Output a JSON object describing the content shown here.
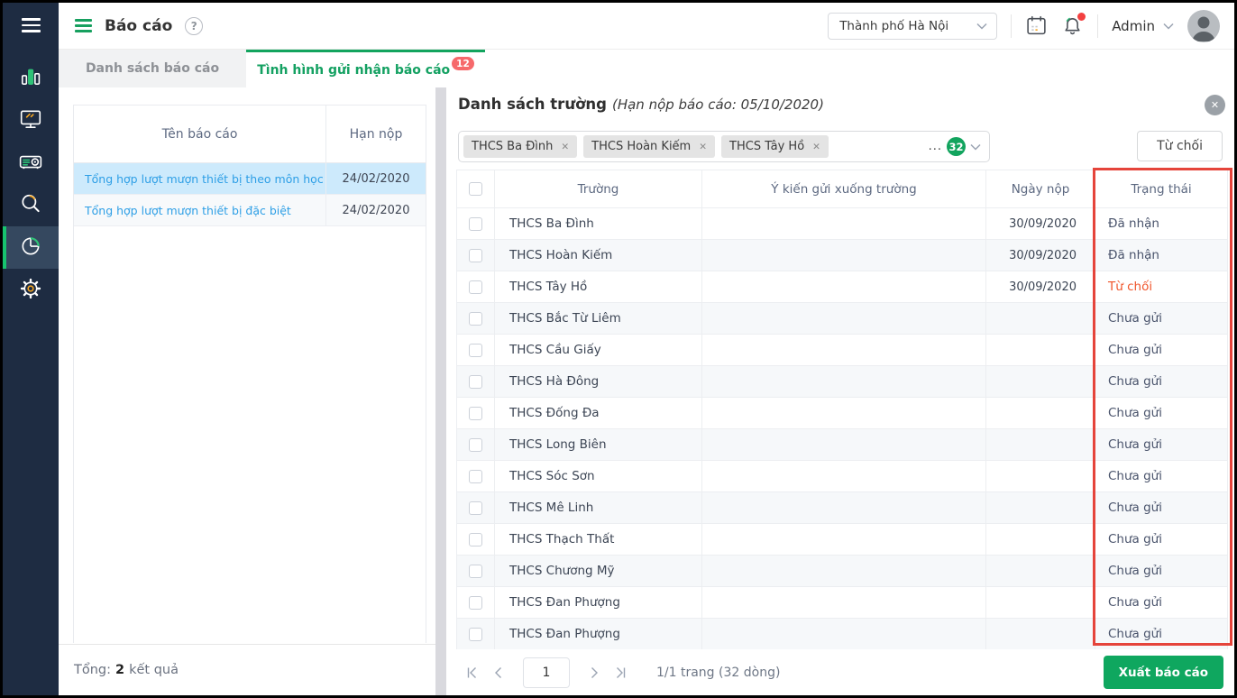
{
  "sidebar": {
    "icons": [
      "bar-chart",
      "monitor",
      "projector",
      "search",
      "pie-chart",
      "settings"
    ],
    "active_icon": "pie-chart"
  },
  "topbar": {
    "title": "Báo cáo",
    "region_select": "Thành phố Hà Nội",
    "username": "Admin"
  },
  "tabs": {
    "tab1": "Danh sách báo cáo",
    "tab2": "Tình hình gửi nhận báo cáo",
    "tab2_badge": "12"
  },
  "left_panel": {
    "columns": {
      "name": "Tên báo cáo",
      "deadline": "Hạn nộp"
    },
    "rows": [
      {
        "name": "Tổng hợp lượt mượn thiết bị theo môn học",
        "deadline": "24/02/2020",
        "selected": true
      },
      {
        "name": "Tổng hợp lượt mượn thiết bị đặc biệt",
        "deadline": "24/02/2020",
        "selected": false
      }
    ],
    "footer": {
      "label": "Tổng:",
      "value": "2",
      "suffix": "kết quả"
    }
  },
  "right_panel": {
    "title": "Danh sách trường",
    "subtitle": "(Hạn nộp báo cáo: 05/10/2020)",
    "filter_tags": [
      "THCS Ba Đình",
      "THCS Hoàn Kiếm",
      "THCS Tây Hồ"
    ],
    "more": {
      "ellipsis": "...",
      "count": "32"
    },
    "reject_button": "Từ chối",
    "table": {
      "columns": {
        "school": "Trường",
        "comment": "Ý kiến gửi xuống trường",
        "date": "Ngày nộp",
        "status": "Trạng thái"
      },
      "rows": [
        {
          "school": "THCS Ba Đình",
          "comment": "",
          "date": "30/09/2020",
          "status": "Đã nhận",
          "status_type": "received"
        },
        {
          "school": "THCS Hoàn Kiếm",
          "comment": "",
          "date": "30/09/2020",
          "status": "Đã nhận",
          "status_type": "received"
        },
        {
          "school": "THCS Tây Hồ",
          "comment": "",
          "date": "30/09/2020",
          "status": "Từ chối",
          "status_type": "rejected"
        },
        {
          "school": "THCS Bắc Từ Liêm",
          "comment": "",
          "date": "",
          "status": "Chưa gửi",
          "status_type": "not_sent"
        },
        {
          "school": "THCS Cầu Giấy",
          "comment": "",
          "date": "",
          "status": "Chưa gửi",
          "status_type": "not_sent"
        },
        {
          "school": "THCS Hà Đông",
          "comment": "",
          "date": "",
          "status": "Chưa gửi",
          "status_type": "not_sent"
        },
        {
          "school": "THCS Đống Đa",
          "comment": "",
          "date": "",
          "status": "Chưa gửi",
          "status_type": "not_sent"
        },
        {
          "school": "THCS Long Biên",
          "comment": "",
          "date": "",
          "status": "Chưa gửi",
          "status_type": "not_sent"
        },
        {
          "school": "THCS Sóc Sơn",
          "comment": "",
          "date": "",
          "status": "Chưa gửi",
          "status_type": "not_sent"
        },
        {
          "school": "THCS Mê Linh",
          "comment": "",
          "date": "",
          "status": "Chưa gửi",
          "status_type": "not_sent"
        },
        {
          "school": "THCS Thạch Thất",
          "comment": "",
          "date": "",
          "status": "Chưa gửi",
          "status_type": "not_sent"
        },
        {
          "school": "THCS Chương Mỹ",
          "comment": "",
          "date": "",
          "status": "Chưa gửi",
          "status_type": "not_sent"
        },
        {
          "school": "THCS Đan Phượng",
          "comment": "",
          "date": "",
          "status": "Chưa gửi",
          "status_type": "not_sent"
        },
        {
          "school": "THCS Đan Phượng",
          "comment": "",
          "date": "",
          "status": "Chưa gửi",
          "status_type": "not_sent"
        }
      ]
    },
    "pagination": {
      "page": "1",
      "info": "1/1 trang (32 dòng)"
    },
    "export_button": "Xuất báo cáo"
  },
  "glyphs": {
    "help": "?",
    "close": "✕",
    "tag_remove": "✕"
  },
  "colors": {
    "accent_green": "#12a45e",
    "sidebar_bg": "#1e2c42",
    "annotation_red": "#e5443b",
    "rejected_text": "#f0562c",
    "link_blue": "#2e9fe6",
    "selected_row_bg": "#cdeafc",
    "badge_red": "#f6696b"
  }
}
